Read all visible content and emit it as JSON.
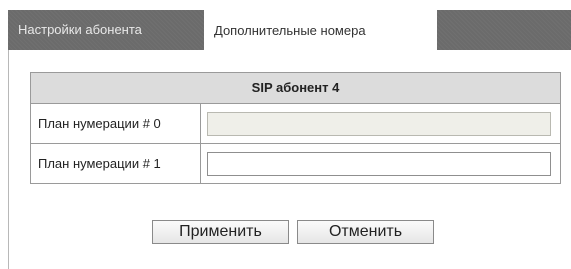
{
  "tabs": [
    {
      "label": "Настройки абонента",
      "active": false
    },
    {
      "label": "Дополнительные номера",
      "active": true
    }
  ],
  "form": {
    "title": "SIP абонент 4",
    "rows": [
      {
        "label": "План нумерации # 0",
        "value": "",
        "disabled": true
      },
      {
        "label": "План нумерации # 1",
        "value": "",
        "disabled": false
      }
    ]
  },
  "buttons": {
    "apply_label": "Применить",
    "cancel_label": "Отменить"
  },
  "colors": {
    "tabbar_bg": "#6b6b6b",
    "header_bg": "#dcdcdc",
    "disabled_input_bg": "#efefe9"
  }
}
